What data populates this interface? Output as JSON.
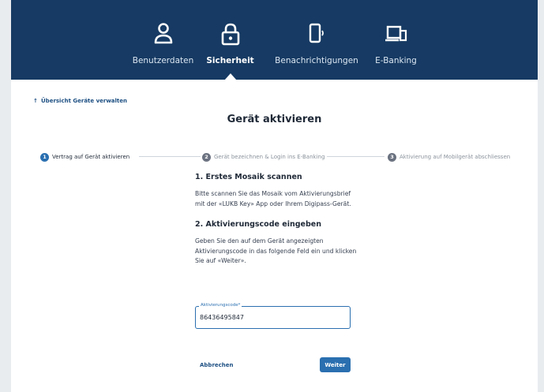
{
  "nav": {
    "items": [
      {
        "label": "Benutzerdaten",
        "icon": "user-icon"
      },
      {
        "label": "Sicherheit",
        "icon": "lock-icon"
      },
      {
        "label": "Benachrichtigungen",
        "icon": "phone-notification-icon"
      },
      {
        "label": "E-Banking",
        "icon": "devices-icon"
      }
    ],
    "active": "Sicherheit"
  },
  "back_link": {
    "label": "Übersicht Geräte verwalten",
    "icon": "arrow-up-icon"
  },
  "page_title": "Gerät aktivieren",
  "stepper": {
    "steps": [
      {
        "num": "1",
        "label": "Vertrag auf Gerät aktivieren",
        "state": "active"
      },
      {
        "num": "2",
        "label": "Gerät bezeichnen & Login ins E-Banking",
        "state": "inactive"
      },
      {
        "num": "3",
        "label": "Aktivierung auf Mobilgerät abschliessen",
        "state": "inactive"
      }
    ]
  },
  "section1": {
    "heading": "1. Erstes Mosaik scannen",
    "text": "Bitte scannen Sie das Mosaik vom Aktivierungsbrief mit der «LUKB Key» App oder Ihrem Digipass-Gerät."
  },
  "section2": {
    "heading": "2. Aktivierungscode eingeben",
    "text": "Geben Sie den auf dem Gerät angezeigten Aktivierungscode in das folgende Feld ein und klicken Sie auf «Weiter»."
  },
  "field": {
    "label": "Aktivierungscode*",
    "value": "86436495847"
  },
  "actions": {
    "cancel": "Abbrechen",
    "next": "Weiter"
  },
  "colors": {
    "nav_bg": "#163a63",
    "accent": "#2a6fb0",
    "link": "#1d4f82"
  }
}
